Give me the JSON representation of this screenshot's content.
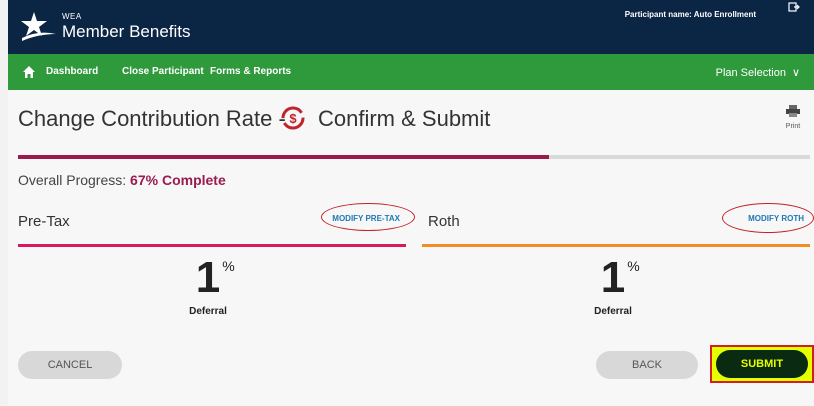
{
  "header": {
    "logo_small": "WEA",
    "logo_brand": "Member Benefits",
    "participant_label": "Participant name:",
    "participant_name": "Auto Enrollment"
  },
  "nav": {
    "items": [
      "Dashboard",
      "Close Participant",
      "Forms & Reports"
    ],
    "plan_selection": "Plan Selection"
  },
  "page": {
    "title": "Change Contribution Rate -",
    "step": "Confirm & Submit",
    "print_label": "Print",
    "progress_label": "Overall Progress:",
    "progress_text": "67% Complete",
    "progress_fraction": 0.67
  },
  "pretax": {
    "label": "Pre-Tax",
    "modify": "MODIFY PRE-TAX",
    "rate": "1",
    "symbol": "%",
    "caption": "Deferral"
  },
  "roth": {
    "label": "Roth",
    "modify": "MODIFY ROTH",
    "rate": "1",
    "symbol": "%",
    "caption": "Deferral"
  },
  "buttons": {
    "cancel": "CANCEL",
    "back": "BACK",
    "submit": "SUBMIT"
  },
  "colors": {
    "header_bg": "#0b2545",
    "nav_bg": "#2f9a3c",
    "progress": "#9b1b4f",
    "pretax_accent": "#d9195f",
    "roth_accent": "#f28c28",
    "highlight": "#e6ff00"
  }
}
